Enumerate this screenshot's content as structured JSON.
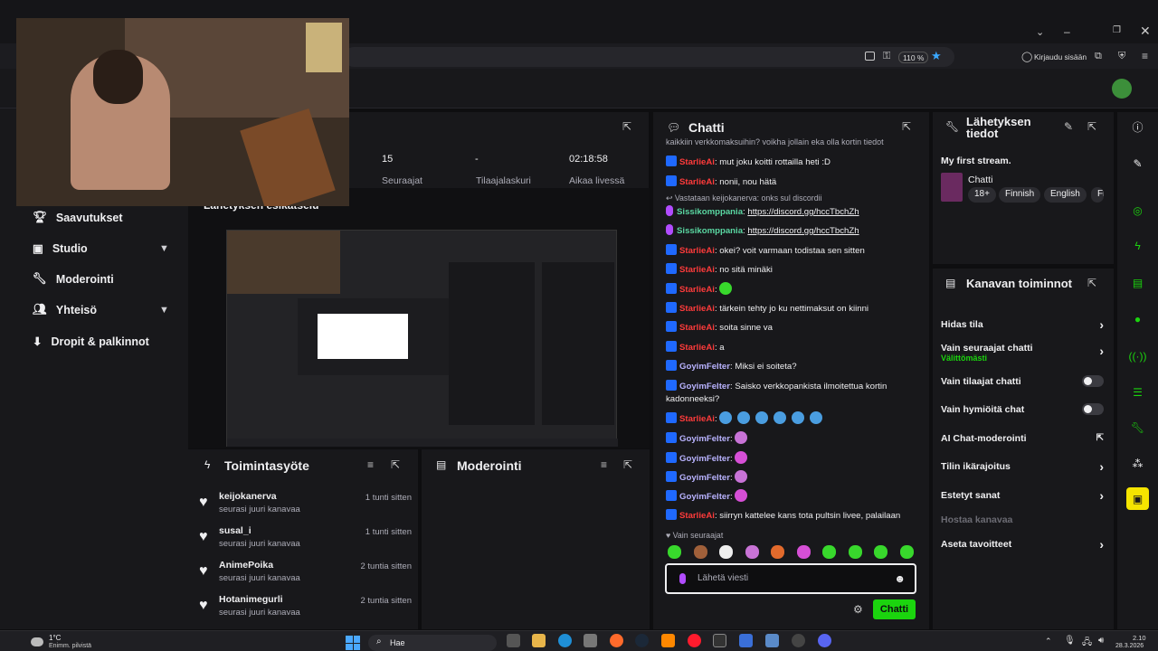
{
  "browser": {
    "zoom": "110 %",
    "login_label": "Kirjaudu sisään"
  },
  "nav": {
    "items": [
      {
        "label": "Saavutukset",
        "icon": "trophy-icon"
      },
      {
        "label": "Studio",
        "icon": "studio-icon",
        "expandable": true
      },
      {
        "label": "Moderointi",
        "icon": "wrench-icon"
      },
      {
        "label": "Yhteisö",
        "icon": "community-icon",
        "expandable": true
      },
      {
        "label": "Dropit & palkinnot",
        "icon": "drops-icon"
      }
    ]
  },
  "stats": {
    "followers_value": "15",
    "followers_label": "Seuraajat",
    "subs_value": "-",
    "subs_label": "Tilaajalaskuri",
    "live_value": "02:18:58",
    "live_label": "Aikaa livessä",
    "preview_heading": "Lähetyksen esikatselu"
  },
  "activity": {
    "title": "Toimintasyöte",
    "items": [
      {
        "name": "keijokanerva",
        "action": "seurasi juuri kanavaa",
        "time": "1 tunti sitten"
      },
      {
        "name": "susal_i",
        "action": "seurasi juuri kanavaa",
        "time": "1 tunti sitten"
      },
      {
        "name": "AnimePoika",
        "action": "seurasi juuri kanavaa",
        "time": "2 tuntia sitten"
      },
      {
        "name": "Hotanimegurli",
        "action": "seurasi juuri kanavaa",
        "time": "2 tuntia sitten"
      }
    ]
  },
  "moderation": {
    "title": "Moderointi"
  },
  "chat": {
    "title": "Chatti",
    "top_partial": "kaikkiin verkkomaksuihin? voikha jollain eka olla kortin tiedot",
    "reply_context": "Vastataan keijokanerva: onks sul discordii",
    "messages": [
      {
        "user": "StarlieAi",
        "text": "mut joku koitti rottailla heti :D"
      },
      {
        "user": "StarlieAi",
        "text": "nonii, nou hätä"
      },
      {
        "user": "Sissikomppania",
        "text": "https://discord.gg/hccTbchZh"
      },
      {
        "user": "Sissikomppania",
        "text": "https://discord.gg/hccTbchZh"
      },
      {
        "user": "StarlieAi",
        "text": "okei? voit varmaan todistaa sen sitten"
      },
      {
        "user": "StarlieAi",
        "text": "no sitä minäki"
      },
      {
        "user": "StarlieAi",
        "text": ""
      },
      {
        "user": "StarlieAi",
        "text": "tärkein tehty jo ku nettimaksut on kiinni"
      },
      {
        "user": "StarlieAi",
        "text": "soita sinne va"
      },
      {
        "user": "StarlieAi",
        "text": "a"
      },
      {
        "user": "GoyimFelter",
        "text": "Miksi ei soiteta?"
      },
      {
        "user": "GoyimFelter",
        "text": "Saisko verkkopankista ilmoitettua kortin kadonneeksi?"
      },
      {
        "user": "StarlieAi",
        "text": ""
      },
      {
        "user": "GoyimFelter",
        "text": ""
      },
      {
        "user": "GoyimFelter",
        "text": ""
      },
      {
        "user": "GoyimFelter",
        "text": ""
      },
      {
        "user": "GoyimFelter",
        "text": ""
      },
      {
        "user": "StarlieAi",
        "text": "siirryn kattelee kans tota pultsin livee, palailaan"
      }
    ],
    "followers_only": "Vain seuraajat",
    "input_placeholder": "Lähetä viesti",
    "send_label": "Chatti"
  },
  "stream_info": {
    "title": "Lähetyksen tiedot",
    "stream_title": "My first stream.",
    "category": "Chatti",
    "tags": [
      "18+",
      "Finnish",
      "English",
      "Fi"
    ]
  },
  "channel_tools": {
    "title": "Kanavan toiminnot",
    "rows": [
      {
        "label": "Hidas tila",
        "control": "chevron"
      },
      {
        "label": "Vain seuraajat chatti",
        "sub": "Välittömästi",
        "control": "chevron"
      },
      {
        "label": "Vain tilaajat chatti",
        "control": "toggle"
      },
      {
        "label": "Vain hymiöitä chat",
        "control": "toggle"
      },
      {
        "label": "AI Chat-moderointi",
        "control": "external"
      },
      {
        "label": "Tilin ikärajoitus",
        "control": "chevron"
      },
      {
        "label": "Estetyt sanat",
        "control": "chevron"
      },
      {
        "label": "Hostaa kanavaa",
        "control": "none",
        "disabled": true
      },
      {
        "label": "Aseta tavoitteet",
        "control": "chevron"
      }
    ]
  },
  "taskbar": {
    "weather_temp": "1°C",
    "weather_text": "Enimm. pilvistä",
    "search_label": "Hae",
    "time": "2.10",
    "date": "28.3.2026"
  },
  "colors": {
    "accent_green": "#1bd40e",
    "bg": "#0e0e10",
    "panel": "#18181b",
    "username_red": "#ff3b3b"
  }
}
